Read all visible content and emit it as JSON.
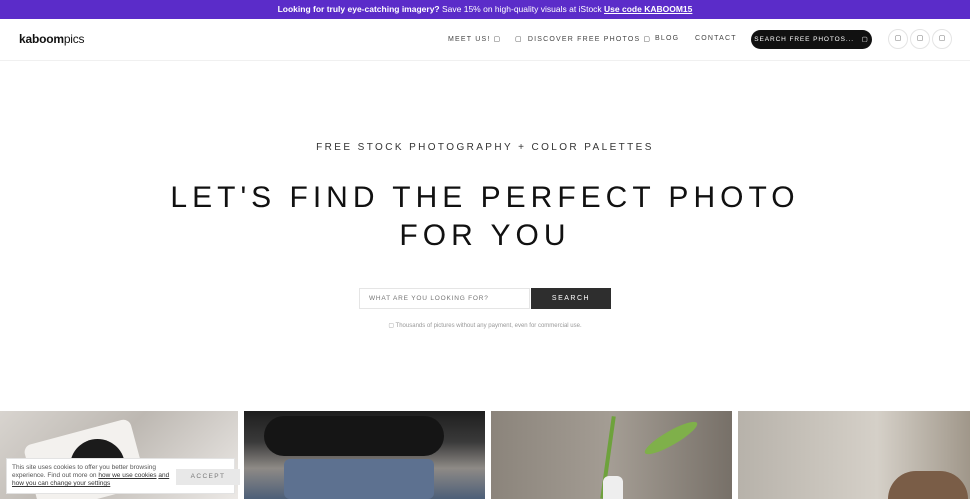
{
  "promo": {
    "lead": "Looking for truly eye-catching imagery?",
    "text": " Save 15% on high-quality visuals at iStock ",
    "code_link": "Use code KABOOM15"
  },
  "header": {
    "logo_bold": "kaboom",
    "logo_light": "pics",
    "nav": [
      {
        "label": "MEET US!",
        "glyph": "▢"
      },
      {
        "label": "DISCOVER FREE PHOTOS",
        "glyph": "▢",
        "lead_glyph": "▢"
      },
      {
        "label": "BLOG"
      },
      {
        "label": "CONTACT"
      }
    ],
    "search_button": "SEARCH FREE PHOTOS...",
    "search_glyph": "▢",
    "social": [
      "▢",
      "▢",
      "▢"
    ]
  },
  "hero": {
    "kicker": "FREE STOCK PHOTOGRAPHY + COLOR PALETTES",
    "headline_line1": "LET'S FIND THE PERFECT PHOTO",
    "headline_line2": "FOR YOU",
    "search_placeholder": "WHAT ARE YOU LOOKING FOR?",
    "search_submit": "SEARCH",
    "note": "▢ Thousands of pictures without any payment, even for commercial use."
  },
  "cookie": {
    "text_start": "This site uses cookies to offer you better browsing experience. Find out more on ",
    "link1": "how we use cookies",
    "text_mid": " ",
    "link2": "and how you can change your settings",
    "accept": "ACCEPT"
  }
}
